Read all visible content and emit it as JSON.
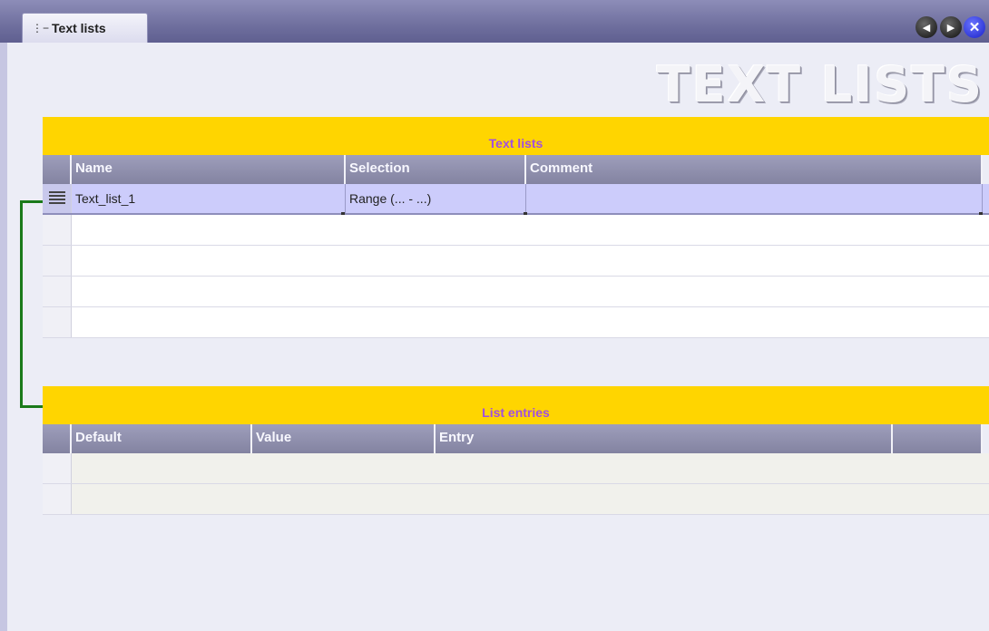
{
  "tab": {
    "label": "Text lists",
    "icon": "text-list-icon"
  },
  "nav": {
    "prev_icon": "arrow-left-icon",
    "next_icon": "arrow-right-icon",
    "close_icon": "close-icon"
  },
  "page_title": "TEXT LISTS",
  "text_lists": {
    "header": "Text lists",
    "columns": [
      "Name",
      "Selection",
      "Comment"
    ],
    "rows": [
      {
        "name": "Text_list_1",
        "selection": "Range (... - ...)",
        "comment": ""
      }
    ]
  },
  "list_entries": {
    "header": "List entries",
    "columns": [
      "Default",
      "Value",
      "Entry",
      ""
    ],
    "rows": []
  },
  "colors": {
    "section_header_bg": "#ffd500",
    "section_header_text": "#a14fe0",
    "column_header_bg": "#8e8eab",
    "selected_row_bg": "#ccccfb",
    "connector_line": "#1a7a1a"
  }
}
